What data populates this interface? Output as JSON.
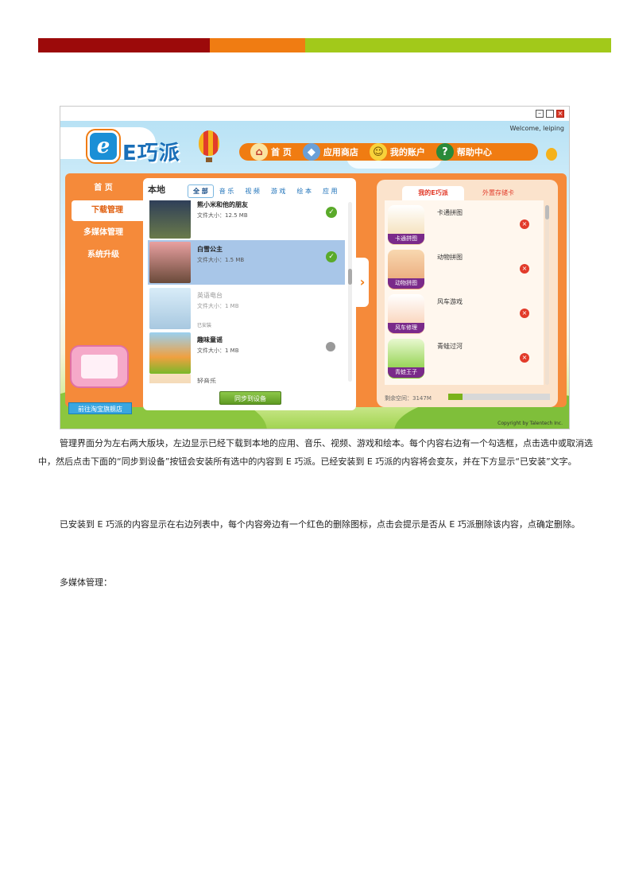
{
  "document": {
    "paragraphs": [
      "管理界面分为左右两大版块，左边显示已经下载到本地的应用、音乐、视频、游戏和绘本。每个内容右边有一个勾选框，点击选中或取消选中，然后点击下面的“同步到设备”按钮会安装所有选中的内容到 E 巧派。已经安装到 E 巧派的内容将会变灰，并在下方显示“已安装”文字。",
      "已安装到 E 巧派的内容显示在右边列表中，每个内容旁边有一个红色的删除图标，点击会提示是否从 E 巧派删除该内容，点确定删除。",
      "多媒体管理："
    ]
  },
  "app": {
    "logo_letter": "e",
    "logo_text": "E巧派",
    "welcome": "Welcome, leiping",
    "nav": [
      {
        "label": "首 页",
        "icon": "house-icon"
      },
      {
        "label": "应用商店",
        "icon": "gift-box-icon"
      },
      {
        "label": "我的账户",
        "icon": "smiley-icon"
      },
      {
        "label": "帮助中心",
        "icon": "question-icon"
      }
    ],
    "side_menu": [
      "首 页",
      "下载管理",
      "多媒体管理",
      "系统升级"
    ],
    "taobao_button": "前往淘宝旗舰店",
    "left_panel": {
      "title": "本地",
      "tabs": [
        "全 部",
        "音 乐",
        "视 频",
        "游 戏",
        "绘 本",
        "应 用"
      ],
      "items": [
        {
          "title": "熊小米和他的朋友",
          "size": "文件大小：12.5 MB",
          "state": "checked"
        },
        {
          "title": "白雪公主",
          "size": "文件大小：1.5 MB",
          "state": "checked"
        },
        {
          "title": "英语电台",
          "size": "文件大小：1 MB",
          "state": "installed",
          "installed_label": "已安装"
        },
        {
          "title": "趣味童谣",
          "size": "文件大小：1 MB",
          "state": "unchecked"
        },
        {
          "title": "轻音乐",
          "size": "",
          "state": "partial"
        }
      ],
      "sync_button": "同步到设备"
    },
    "right_panel": {
      "tabs": [
        "我的E巧派",
        "外置存储卡"
      ],
      "items": [
        {
          "title": "卡通拼图",
          "icon_label": "卡通拼图"
        },
        {
          "title": "动物拼图",
          "icon_label": "动物拼图"
        },
        {
          "title": "风车游戏",
          "icon_label": "风车修理"
        },
        {
          "title": "青蛙过河",
          "icon_label": "青蛙王子"
        }
      ],
      "space_label": "剩余空间：3147M",
      "space_used_fraction": 0.14
    },
    "copyright": "Copyright by Talentech Inc."
  },
  "colors": {
    "bar_red": "#9c0a0a",
    "bar_orange": "#f07c12",
    "bar_green": "#a2c91a",
    "panel_orange": "#f58a3a",
    "selected_row": "#a8c6e8",
    "delete_red": "#e23b2a"
  }
}
